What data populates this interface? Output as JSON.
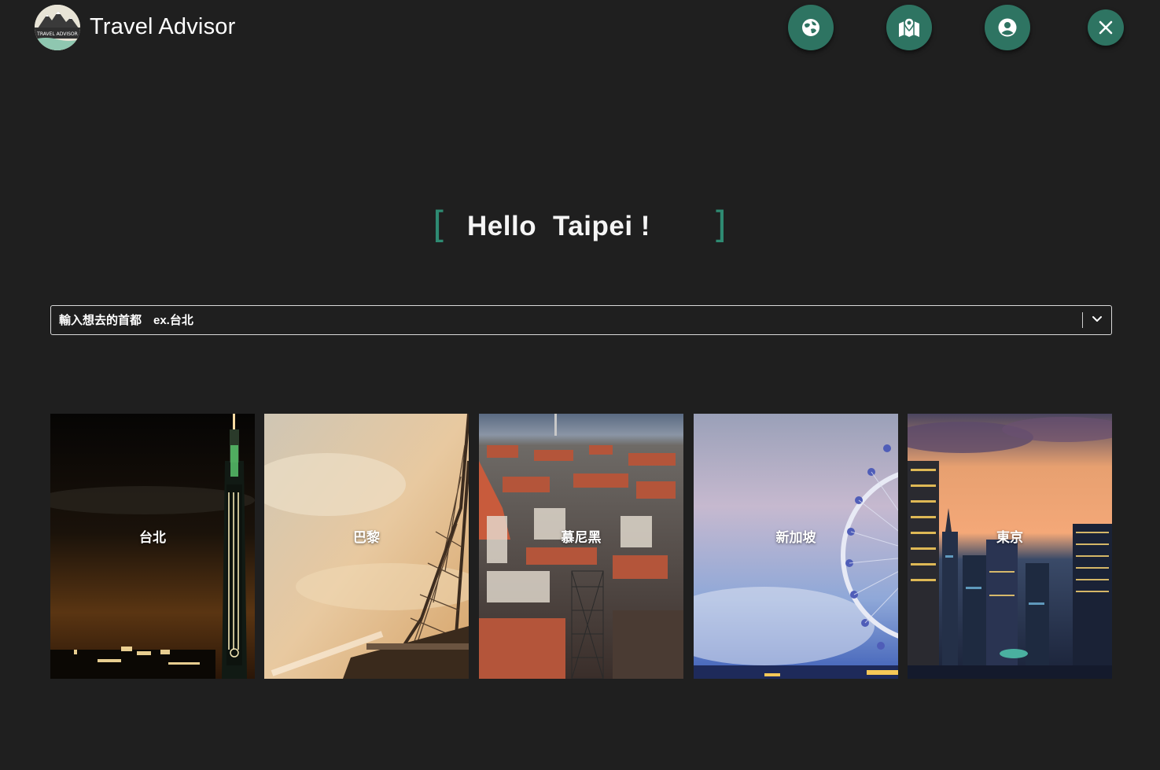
{
  "header": {
    "logo_text": "TRAVEL ADVISOR",
    "title": "Travel Advisor",
    "nav_buttons": [
      {
        "icon": "globe-icon"
      },
      {
        "icon": "map-pin-icon"
      },
      {
        "icon": "user-circle-icon"
      },
      {
        "icon": "close-icon"
      }
    ]
  },
  "hero": {
    "bracket_left": "[",
    "greeting": "Hello",
    "city": "Taipei !",
    "bracket_right": "]"
  },
  "search": {
    "placeholder": "輸入想去的首都　ex.台北",
    "dropdown_icon": "chevron-down-icon"
  },
  "cities": [
    {
      "label": "台北"
    },
    {
      "label": "巴黎"
    },
    {
      "label": "慕尼黑"
    },
    {
      "label": "新加坡"
    },
    {
      "label": "東京"
    }
  ],
  "colors": {
    "background": "#1f1f1f",
    "accent": "#2e7462",
    "bracket": "#2e8a72",
    "text": "#ffffff"
  }
}
